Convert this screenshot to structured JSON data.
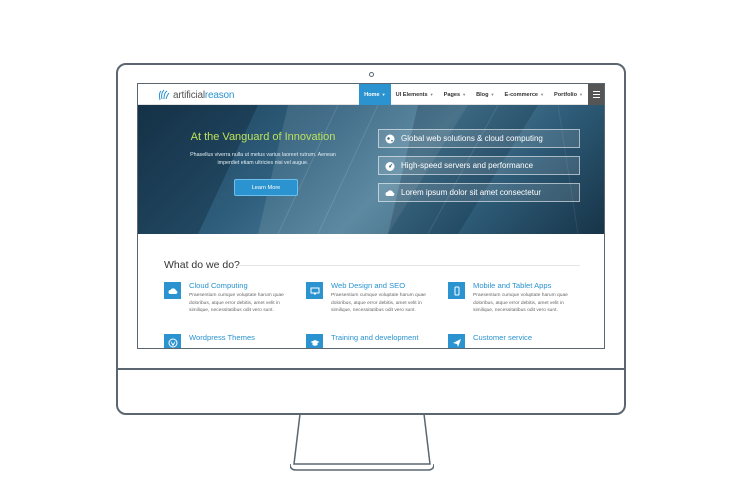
{
  "site": {
    "logo": {
      "part1": "artificial",
      "part2": "reason"
    },
    "nav": [
      {
        "label": "Home",
        "active": true
      },
      {
        "label": "UI Elements",
        "active": false
      },
      {
        "label": "Pages",
        "active": false
      },
      {
        "label": "Blog",
        "active": false
      },
      {
        "label": "E-commerce",
        "active": false
      },
      {
        "label": "Portfolio",
        "active": false
      }
    ],
    "menu_icon": "hamburger-icon"
  },
  "hero": {
    "title": "At the Vanguard of Innovation",
    "text": "Phasellus viverra nulla ut metus varius laoreet rutrum. Aenean imperdiet etiam ultricies nisi vel augue.",
    "button": "Learn More",
    "features": [
      {
        "icon": "globe-icon",
        "label": "Global web solutions & cloud computing"
      },
      {
        "icon": "dashboard-icon",
        "label": "High-speed servers and performance"
      },
      {
        "icon": "cloud-icon",
        "label": "Lorem ipsum dolor sit amet consectetur"
      }
    ]
  },
  "services": {
    "heading": "What do we do?",
    "items": [
      {
        "icon": "cloud-icon",
        "title": "Cloud Computing",
        "text": "Praesentium cumque voluptate harum quae doloribus, atque error debitis, amet velit in similique, necessitatibus odit vero sunt."
      },
      {
        "icon": "monitor-icon",
        "title": "Web Design and SEO",
        "text": "Praesentium cumque voluptate harum quae doloribus, atque error debitis, amet velit in similique, necessitatibus odit vero sunt."
      },
      {
        "icon": "tablet-icon",
        "title": "Mobile and Tablet Apps",
        "text": "Praesentium cumque voluptate harum quae doloribus, atque error debitis, amet velit in similique, necessitatibus odit vero sunt."
      },
      {
        "icon": "wordpress-icon",
        "title": "Wordpress Themes",
        "text": ""
      },
      {
        "icon": "graduation-cap-icon",
        "title": "Training and development",
        "text": ""
      },
      {
        "icon": "paper-plane-icon",
        "title": "Customer service",
        "text": ""
      }
    ]
  },
  "colors": {
    "accent": "#2a93d0",
    "hero_title": "#bde35a",
    "frame": "#5b6670"
  }
}
